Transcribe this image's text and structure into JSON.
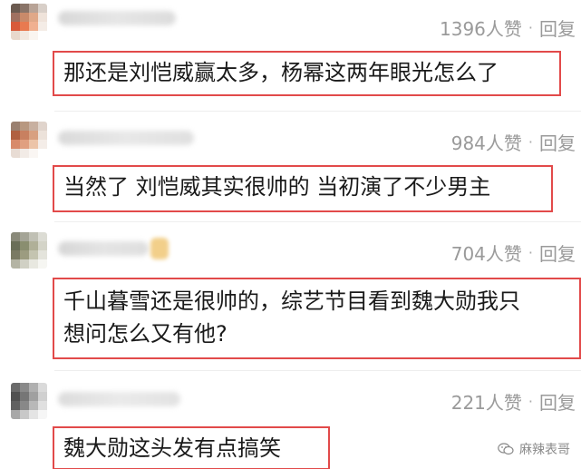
{
  "comments": [
    {
      "likes": "1396人赞",
      "separator": "·",
      "reply": "回复",
      "text": "那还是刘恺威赢太多，杨幂这两年眼光怎么了"
    },
    {
      "likes": "984人赞",
      "separator": "·",
      "reply": "回复",
      "text": "当然了 刘恺威其实很帅的 当初演了不少男主"
    },
    {
      "likes": "704人赞",
      "separator": "·",
      "reply": "回复",
      "text_line1": "千山暮雪还是很帅的，综艺节目看到魏大勋我只",
      "text_line2": "想问怎么又有他?"
    },
    {
      "likes": "221人赞",
      "separator": "·",
      "reply": "回复",
      "text": "魏大勋这头发有点搞笑"
    }
  ],
  "watermark": {
    "text": "麻辣表哥",
    "icon": "wechat-icon"
  },
  "colors": {
    "highlight_border": "#e24a4a",
    "meta_text": "#9a9a9a",
    "body_text": "#1a1a1a"
  }
}
